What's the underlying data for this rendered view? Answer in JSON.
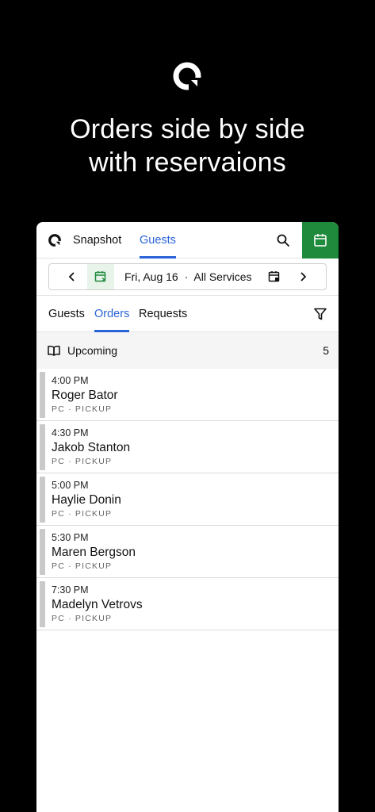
{
  "promo": {
    "logo_icon": "app-logo-icon",
    "headline_line1": "Orders side by side",
    "headline_line2": "with reservaions"
  },
  "header": {
    "app_icon": "app-logo-icon",
    "tabs": [
      {
        "label": "Snapshot",
        "active": false
      },
      {
        "label": "Guests",
        "active": true
      }
    ],
    "search_icon": "search-icon",
    "calendar_icon": "calendar-icon",
    "accent_color": "#1f8a3c",
    "active_tab_color": "#2a63d8"
  },
  "datebar": {
    "prev_icon": "chevron-left-icon",
    "next_icon": "chevron-right-icon",
    "date": "Fri, Aug 16",
    "separator": "·",
    "service": "All Services"
  },
  "subtabs": {
    "items": [
      {
        "label": "Guests",
        "active": false
      },
      {
        "label": "Orders",
        "active": true
      },
      {
        "label": "Requests",
        "active": false
      }
    ],
    "filter_icon": "filter-icon"
  },
  "section": {
    "icon": "book-icon",
    "title": "Upcoming",
    "count": "5"
  },
  "orders": [
    {
      "time": "4:00 PM",
      "name": "Roger Bator",
      "meta": "PC · PICKUP"
    },
    {
      "time": "4:30 PM",
      "name": "Jakob Stanton",
      "meta": "PC · PICKUP"
    },
    {
      "time": "5:00 PM",
      "name": "Haylie Donin",
      "meta": "PC · PICKUP"
    },
    {
      "time": "5:30 PM",
      "name": "Maren Bergson",
      "meta": "PC · PICKUP"
    },
    {
      "time": "7:30 PM",
      "name": "Madelyn Vetrovs",
      "meta": "PC · PICKUP"
    }
  ]
}
